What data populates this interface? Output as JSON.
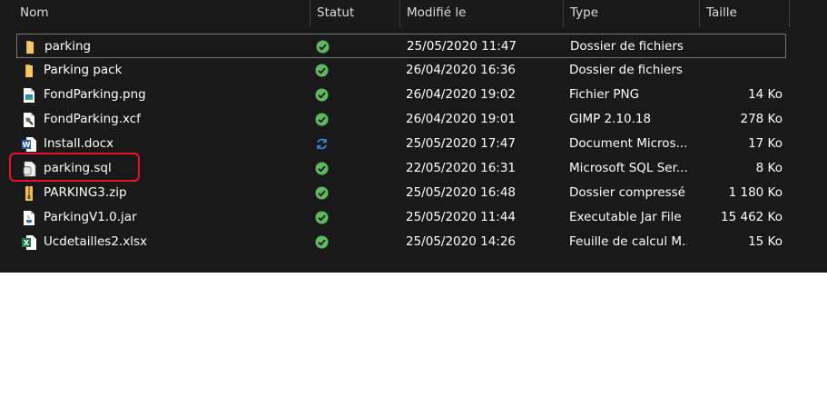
{
  "columns": {
    "name": "Nom",
    "status": "Statut",
    "modified": "Modifié le",
    "type": "Type",
    "size": "Taille"
  },
  "colors": {
    "background": "#191919",
    "synced_green": "#5fb85f",
    "syncing_blue": "#3a8ee6",
    "annotation_red": "#e8132a",
    "folder_yellow": "#e8b84a"
  },
  "files": [
    {
      "name": "parking",
      "icon": "folder-icon",
      "status": "synced",
      "modified": "25/05/2020 11:47",
      "type": "Dossier de fichiers",
      "size": ""
    },
    {
      "name": "Parking pack",
      "icon": "folder-icon",
      "status": "synced",
      "modified": "26/04/2020 16:36",
      "type": "Dossier de fichiers",
      "size": ""
    },
    {
      "name": "FondParking.png",
      "icon": "png-image-icon",
      "status": "synced",
      "modified": "26/04/2020 19:02",
      "type": "Fichier PNG",
      "size": "14 Ko"
    },
    {
      "name": "FondParking.xcf",
      "icon": "gimp-file-icon",
      "status": "synced",
      "modified": "26/04/2020 19:01",
      "type": "GIMP 2.10.18",
      "size": "278 Ko"
    },
    {
      "name": "Install.docx",
      "icon": "word-document-icon",
      "status": "syncing",
      "modified": "25/05/2020 17:47",
      "type": "Document Micros...",
      "size": "17 Ko"
    },
    {
      "name": "parking.sql",
      "icon": "sql-file-icon",
      "status": "synced",
      "modified": "22/05/2020 16:31",
      "type": "Microsoft SQL Ser...",
      "size": "8 Ko"
    },
    {
      "name": "PARKING3.zip",
      "icon": "zip-archive-icon",
      "status": "synced",
      "modified": "25/05/2020 16:48",
      "type": "Dossier compressé",
      "size": "1 180 Ko"
    },
    {
      "name": "ParkingV1.0.jar",
      "icon": "java-jar-icon",
      "status": "synced",
      "modified": "25/05/2020 11:44",
      "type": "Executable Jar File",
      "size": "15 462 Ko"
    },
    {
      "name": "Ucdetailles2.xlsx",
      "icon": "excel-sheet-icon",
      "status": "synced",
      "modified": "25/05/2020 14:26",
      "type": "Feuille de calcul M...",
      "size": "15 Ko"
    }
  ]
}
